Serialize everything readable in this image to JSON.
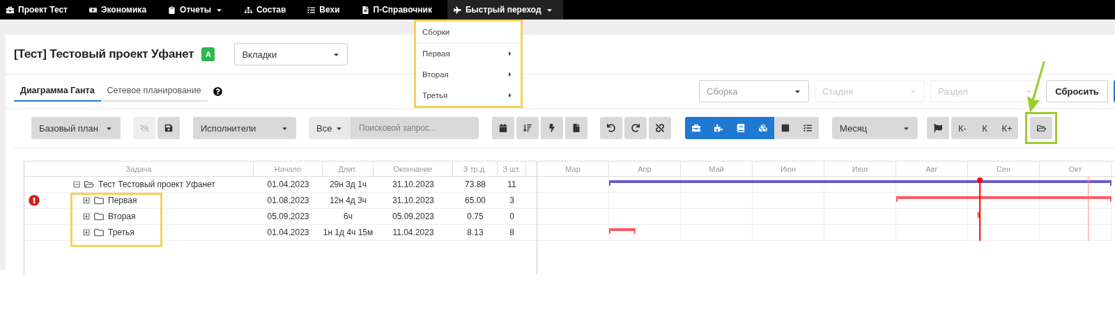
{
  "nav": {
    "items": [
      {
        "label": "Проект Тест",
        "has_caret": false,
        "selected": false
      },
      {
        "label": "Экономика",
        "has_caret": false,
        "selected": false
      },
      {
        "label": "Отчеты",
        "has_caret": true,
        "selected": false
      },
      {
        "label": "Состав",
        "has_caret": false,
        "selected": false
      },
      {
        "label": "Вехи",
        "has_caret": false,
        "selected": false
      },
      {
        "label": "П-Справочник",
        "has_caret": false,
        "selected": false
      },
      {
        "label": "Быстрый переход",
        "has_caret": true,
        "selected": true
      }
    ],
    "dropdown": [
      {
        "label": "Сборки",
        "has_submenu": false
      },
      {
        "label": "Первая",
        "has_submenu": true
      },
      {
        "label": "Вторая",
        "has_submenu": true
      },
      {
        "label": "Третья",
        "has_submenu": true
      }
    ]
  },
  "header": {
    "title": "[Тест] Тестовый проект Уфанет",
    "badge": "А",
    "tabs_select": "Вкладки"
  },
  "tabs": [
    {
      "label": "Диаграмма Ганта",
      "selected": true
    },
    {
      "label": "Сетевое планирование",
      "selected": false
    }
  ],
  "filters": [
    {
      "placeholder": "Сборка",
      "disabled": false
    },
    {
      "placeholder": "Стадия",
      "disabled": true
    },
    {
      "placeholder": "Раздел",
      "disabled": true
    }
  ],
  "reset_button": "Сбросить",
  "toolbar": {
    "baseline_select": "Базовый план",
    "hide_disabled": true,
    "executors_select": "Исполнители",
    "scope_select": "Все",
    "search_placeholder": "Поисковой запрос...",
    "view_buttons": [
      {
        "selected": true
      },
      {
        "selected": true
      },
      {
        "selected": true
      },
      {
        "selected": true
      },
      {
        "selected": false
      },
      {
        "selected": false
      }
    ],
    "scale_select": "Месяц",
    "zoom_buttons": [
      "К-",
      "К",
      "К+"
    ]
  },
  "table": {
    "columns": [
      "Задача",
      "Начало",
      "Длит.",
      "Окончание",
      "З тр.д.",
      "З шт."
    ],
    "rows": [
      {
        "name": "Тест Тестовый проект Уфанет",
        "start": "01.04.2023",
        "duration": "29н 3д 1ч",
        "end": "31.10.2023",
        "labor": "73.88",
        "pieces": "11",
        "expanded": true,
        "warning": false,
        "color": "#6a5acd",
        "children": [
          {
            "name": "Первая",
            "start": "01.08.2023",
            "duration": "12н 4д 3ч",
            "end": "31.10.2023",
            "labor": "65.00",
            "pieces": "3",
            "expanded": false,
            "warning": true,
            "color": "#ff5a5f"
          },
          {
            "name": "Вторая",
            "start": "05.09.2023",
            "duration": "6ч",
            "end": "05.09.2023",
            "labor": "0.75",
            "pieces": "0",
            "expanded": false,
            "warning": false,
            "color": "#ff5a5f"
          },
          {
            "name": "Третья",
            "start": "01.04.2023",
            "duration": "1н 1д 4ч 15м",
            "end": "11.04.2023",
            "labor": "8.13",
            "pieces": "8",
            "expanded": false,
            "warning": false,
            "color": "#ff5a5f"
          }
        ]
      }
    ]
  },
  "gantt": {
    "months": [
      "Мар",
      "Апр",
      "Май",
      "Июн",
      "Июл",
      "Авг",
      "Сен",
      "Окт"
    ]
  }
}
